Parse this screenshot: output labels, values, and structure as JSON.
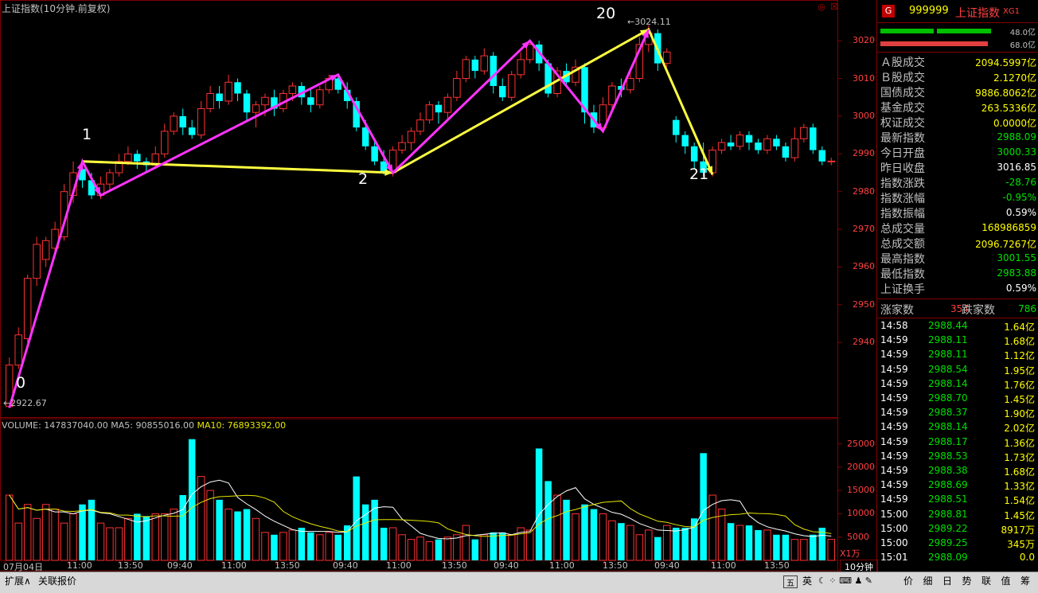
{
  "title": "上证指数(10分钟.前复权)",
  "volume_legend": {
    "vol": "VOLUME: 147837040.00",
    "ma5": "MA5: 90855016.00",
    "ma10": "MA10: 76893392.00"
  },
  "vol_unit": "X1万",
  "period_label": "10分钟",
  "price_axis": [
    "3020",
    "3010",
    "3000",
    "2990",
    "2980",
    "2970",
    "2960",
    "2950",
    "2940"
  ],
  "vol_axis": [
    "25000",
    "20000",
    "15000",
    "10000",
    "5000"
  ],
  "x_axis": [
    "07月04日",
    "11:00",
    "13:50",
    "09:40",
    "11:00",
    "13:50",
    "09:40",
    "11:00",
    "13:50",
    "09:40",
    "11:00",
    "13:50",
    "09:40",
    "11:00",
    "13:50"
  ],
  "annotations": [
    "0",
    "1",
    "2",
    "20",
    "21"
  ],
  "point_labels": {
    "low": "2922.67",
    "high": "3024.11"
  },
  "panel": {
    "badge": "G",
    "code": "999999",
    "name": "上证指数",
    "tag": "XG1",
    "bar1_label": "48.0亿",
    "bar2_label": "68.0亿",
    "rows": [
      {
        "k": "Ａ股成交",
        "v": "2094.5997亿",
        "c": "#ffff00"
      },
      {
        "k": "Ｂ股成交",
        "v": "2.1270亿",
        "c": "#ffff00"
      },
      {
        "k": "国债成交",
        "v": "9886.8062亿",
        "c": "#ffff00"
      },
      {
        "k": "基金成交",
        "v": "263.5336亿",
        "c": "#ffff00"
      },
      {
        "k": "权证成交",
        "v": "0.0000亿",
        "c": "#ffff00"
      },
      {
        "k": "最新指数",
        "v": "2988.09",
        "c": "#00e000"
      },
      {
        "k": "今日开盘",
        "v": "3000.33",
        "c": "#00e000"
      },
      {
        "k": "昨日收盘",
        "v": "3016.85",
        "c": "#ffffff"
      },
      {
        "k": "指数涨跌",
        "v": "-28.76",
        "c": "#00e000"
      },
      {
        "k": "指数涨幅",
        "v": "-0.95%",
        "c": "#00e000"
      },
      {
        "k": "指数振幅",
        "v": "0.59%",
        "c": "#ffffff"
      },
      {
        "k": "总成交量",
        "v": "168986859",
        "c": "#ffff00"
      },
      {
        "k": "总成交额",
        "v": "2096.7267亿",
        "c": "#ffff00"
      },
      {
        "k": "最高指数",
        "v": "3001.55",
        "c": "#00e000"
      },
      {
        "k": "最低指数",
        "v": "2983.88",
        "c": "#00e000"
      },
      {
        "k": "上证换手",
        "v": "0.59%",
        "c": "#ffffff"
      }
    ],
    "up_label": "涨家数",
    "up_count": "354",
    "down_label": "跌家数",
    "down_count": "786",
    "ticks": [
      [
        "14:58",
        "2988.44",
        "1.64亿"
      ],
      [
        "14:59",
        "2988.11",
        "1.68亿"
      ],
      [
        "14:59",
        "2988.11",
        "1.12亿"
      ],
      [
        "14:59",
        "2988.54",
        "1.95亿"
      ],
      [
        "14:59",
        "2988.14",
        "1.76亿"
      ],
      [
        "14:59",
        "2988.70",
        "1.45亿"
      ],
      [
        "14:59",
        "2988.37",
        "1.90亿"
      ],
      [
        "14:59",
        "2988.14",
        "2.02亿"
      ],
      [
        "14:59",
        "2988.17",
        "1.36亿"
      ],
      [
        "14:59",
        "2988.53",
        "1.73亿"
      ],
      [
        "14:59",
        "2988.38",
        "1.68亿"
      ],
      [
        "14:59",
        "2988.69",
        "1.33亿"
      ],
      [
        "14:59",
        "2988.51",
        "1.54亿"
      ],
      [
        "15:00",
        "2988.81",
        "1.45亿"
      ],
      [
        "15:00",
        "2989.22",
        "8917万"
      ],
      [
        "15:00",
        "2989.25",
        "345万"
      ],
      [
        "15:01",
        "2988.09",
        "0.0"
      ]
    ]
  },
  "bottom_tabs": {
    "left": [
      "扩展∧",
      "关联报价"
    ],
    "right": [
      "价",
      "细",
      "日",
      "势",
      "联",
      "值",
      "筹"
    ],
    "ime": "英"
  },
  "chart_data": {
    "type": "candlestick",
    "title": "上证指数(10分钟.前复权)",
    "ylim": [
      2920,
      3027
    ],
    "candles": [
      [
        2923,
        2934,
        2922.67,
        2936
      ],
      [
        2934,
        2942,
        2933,
        2944
      ],
      [
        2941,
        2957,
        2940,
        2958
      ],
      [
        2957,
        2966,
        2955,
        2968
      ],
      [
        2962,
        2967,
        2960,
        2968
      ],
      [
        2965,
        2970,
        2963,
        2972
      ],
      [
        2968,
        2980,
        2967,
        2982
      ],
      [
        2979,
        2985,
        2977,
        2988
      ],
      [
        2986,
        2983,
        2981,
        2988
      ],
      [
        2983,
        2979,
        2978,
        2985
      ],
      [
        2979,
        2982,
        2978,
        2984
      ],
      [
        2982,
        2985,
        2980,
        2986
      ],
      [
        2985,
        2988,
        2984,
        2990
      ],
      [
        2988,
        2990,
        2987,
        2992
      ],
      [
        2990,
        2988,
        2986,
        2991
      ],
      [
        2988,
        2987,
        2985,
        2989
      ],
      [
        2987,
        2990,
        2986,
        2992
      ],
      [
        2990,
        2996,
        2989,
        2998
      ],
      [
        2996,
        3000,
        2995,
        3001
      ],
      [
        3000,
        2997,
        2995,
        3002
      ],
      [
        2997,
        2995,
        2994,
        2999
      ],
      [
        2995,
        3002,
        2994,
        3004
      ],
      [
        3002,
        3006,
        3001,
        3008
      ],
      [
        3006,
        3004,
        3002,
        3008
      ],
      [
        3004,
        3009,
        3003,
        3011
      ],
      [
        3009,
        3006,
        3004,
        3010
      ],
      [
        3006,
        3001,
        2999,
        3007
      ],
      [
        3001,
        3003,
        2997,
        3004
      ],
      [
        3003,
        3005,
        3000,
        3006
      ],
      [
        3005,
        3002,
        3000,
        3007
      ],
      [
        3002,
        3006,
        3001,
        3007
      ],
      [
        3006,
        3008,
        3004,
        3009
      ],
      [
        3008,
        3005,
        3003,
        3009
      ],
      [
        3005,
        3003,
        3001,
        3007
      ],
      [
        3003,
        3007,
        3002,
        3008
      ],
      [
        3007,
        3010,
        3006,
        3011
      ],
      [
        3010,
        3007,
        3006,
        3011
      ],
      [
        3007,
        3004,
        3002,
        3009
      ],
      [
        3004,
        2997,
        2996,
        3005
      ],
      [
        2997,
        2992,
        2991,
        2999
      ],
      [
        2992,
        2988,
        2987,
        2994
      ],
      [
        2988,
        2985,
        2984.5,
        2991
      ],
      [
        2985,
        2991,
        2984,
        2992
      ],
      [
        2991,
        2993,
        2990,
        2995
      ],
      [
        2993,
        2996,
        2991,
        2997
      ],
      [
        2996,
        2999,
        2995,
        3001
      ],
      [
        2999,
        3003,
        2998,
        3004
      ],
      [
        3003,
        3001,
        2998,
        3004
      ],
      [
        3001,
        3005,
        2999,
        3006
      ],
      [
        3005,
        3010,
        3004,
        3012
      ],
      [
        3010,
        3015,
        3009,
        3016
      ],
      [
        3015,
        3012,
        3010,
        3016
      ],
      [
        3012,
        3016,
        3011,
        3018
      ],
      [
        3016,
        3008,
        3006,
        3017
      ],
      [
        3008,
        3005,
        3004,
        3010
      ],
      [
        3005,
        3011,
        3004,
        3012
      ],
      [
        3011,
        3015,
        3010,
        3017
      ],
      [
        3015,
        3019,
        3014,
        3020
      ],
      [
        3019,
        3014,
        3012,
        3020
      ],
      [
        3014,
        3006,
        3005,
        3015
      ],
      [
        3006,
        3012,
        3005,
        3013
      ],
      [
        3012,
        3009,
        3008,
        3014
      ],
      [
        3009,
        3013,
        3008,
        3015
      ],
      [
        3013,
        3001,
        2998,
        3014
      ],
      [
        3001,
        2997,
        2995.5,
        3003
      ],
      [
        2997,
        3003,
        2996,
        3005
      ],
      [
        3003,
        3008,
        3002,
        3009
      ],
      [
        3008,
        3007,
        3005,
        3010
      ],
      [
        3007,
        3010,
        3006,
        3012
      ],
      [
        3010,
        3019,
        3009,
        3021
      ],
      [
        3019,
        3022,
        3017,
        3024.11
      ],
      [
        3022,
        3014,
        3012,
        3023
      ],
      [
        3014,
        3017,
        3013,
        3018
      ],
      [
        2999,
        2995,
        2993,
        3000
      ],
      [
        2995,
        2992,
        2990,
        2996
      ],
      [
        2992,
        2988,
        2986,
        2993
      ],
      [
        2988,
        2985,
        2984,
        2993
      ],
      [
        2985,
        2991,
        2984,
        2992
      ],
      [
        2991,
        2993,
        2990,
        2994
      ],
      [
        2993,
        2992,
        2991,
        2995
      ],
      [
        2992,
        2995,
        2991,
        2996
      ],
      [
        2995,
        2993,
        2991,
        2996
      ],
      [
        2993,
        2991,
        2990,
        2994
      ],
      [
        2991,
        2994,
        2990,
        2995
      ],
      [
        2994,
        2992,
        2991,
        2995
      ],
      [
        2992,
        2989,
        2988,
        2993
      ],
      [
        2989,
        2994,
        2988,
        2997
      ],
      [
        2994,
        2997,
        2993,
        2998
      ],
      [
        2997,
        2991,
        2990,
        2998
      ],
      [
        2991,
        2988,
        2987,
        2992
      ],
      [
        2988,
        2988.09,
        2987,
        2989
      ]
    ],
    "volume": [
      14000,
      8000,
      12000,
      9000,
      12000,
      11000,
      8000,
      10000,
      12000,
      13000,
      8000,
      7000,
      7000,
      9000,
      10000,
      9500,
      10000,
      10000,
      11000,
      14000,
      26000,
      18000,
      15000,
      13000,
      11000,
      10500,
      11000,
      9000,
      6000,
      5500,
      6000,
      6500,
      7000,
      6000,
      5500,
      6000,
      5500,
      7500,
      18000,
      12000,
      13000,
      7000,
      7000,
      5500,
      4500,
      5000,
      4000,
      4500,
      5000,
      5500,
      7500,
      4500,
      5500,
      6000,
      6000,
      5500,
      7000,
      6500,
      24000,
      17000,
      14000,
      13000,
      10000,
      12000,
      11000,
      10000,
      8500,
      8000,
      7500,
      5500,
      6500,
      5000,
      7500,
      7000,
      7000,
      9000,
      23000,
      14000,
      11000,
      8000,
      7500,
      7500,
      6500,
      6500,
      5500,
      5500,
      4500,
      4500,
      5500,
      7000,
      4500,
      5000,
      11000,
      14800
    ],
    "waves": {
      "magenta": [
        [
          0,
          2922.67
        ],
        [
          8,
          2988
        ],
        [
          10,
          2979
        ],
        [
          36,
          3011
        ],
        [
          42,
          2985
        ],
        [
          57,
          3020
        ],
        [
          65,
          2996
        ],
        [
          70,
          3023
        ]
      ],
      "yellow": [
        [
          8,
          2988
        ],
        [
          42,
          2985
        ],
        [
          70,
          3023
        ],
        [
          77,
          2984.5
        ]
      ]
    }
  }
}
